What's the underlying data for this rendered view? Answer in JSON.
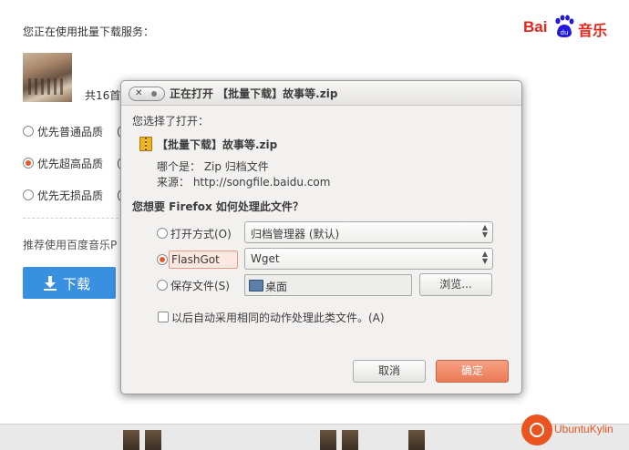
{
  "page": {
    "intro": "您正在使用批量下载服务：",
    "logo_bai": "Bai",
    "logo_du": "du",
    "logo_music": "音乐",
    "song_count": "共16首",
    "quality_options": [
      {
        "label": "优先普通品质",
        "suffix": "（",
        "selected": false
      },
      {
        "label": "优先超高品质",
        "suffix": "（",
        "selected": true
      },
      {
        "label": "优先无损品质",
        "suffix": "（",
        "selected": false
      }
    ],
    "recommend": "推荐使用百度音乐P",
    "download_label": "下载",
    "accent": "#3a90e0"
  },
  "dialog": {
    "title": "正在打开 【批量下载】故事等.zip",
    "chosen_label": "您选择了打开：",
    "file_name": "【批量下载】故事等.zip",
    "type_line": "哪个是： Zip 归档文件",
    "source_line": "来源： http://songfile.baidu.com",
    "question": "您想要 Firefox 如何处理此文件？",
    "open_with_label": "打开方式(O)",
    "open_with_value": "归档管理器 (默认)",
    "flashgot_label": "FlashGot",
    "flashgot_value": "Wget",
    "save_label": "保存文件(S)",
    "save_folder": "桌面",
    "browse_label": "浏览...",
    "auto_label": "以后自动采用相同的动作处理此类文件。(A)",
    "cancel_label": "取消",
    "ok_label": "确定",
    "primary_color": "#ea7a55"
  },
  "watermark": {
    "text": "UbuntuKylin"
  }
}
